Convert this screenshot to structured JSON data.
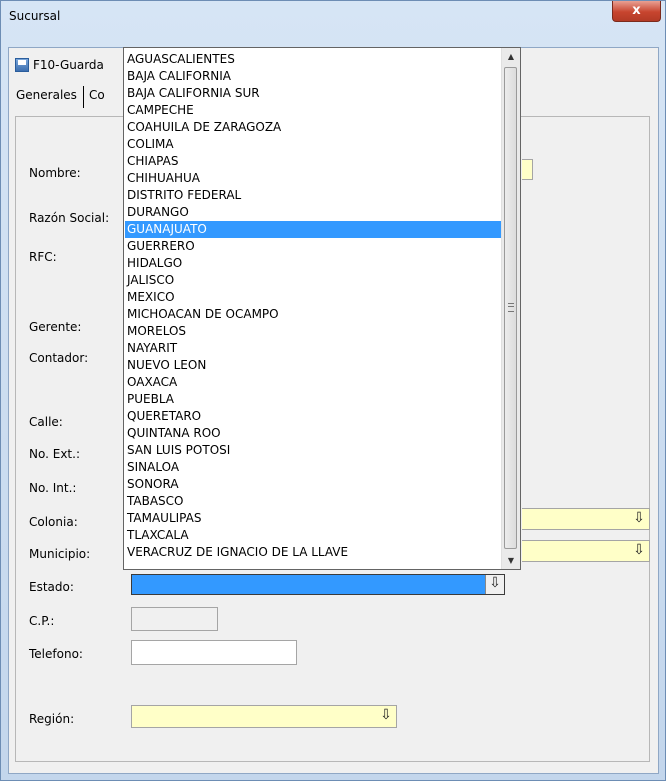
{
  "window": {
    "title": "Sucursal",
    "close_label": "x"
  },
  "toolbar": {
    "save_label": "F10-Guarda",
    "save_icon": "floppy-disk-icon"
  },
  "tabs": [
    {
      "label": "Generales"
    },
    {
      "label": "Co"
    }
  ],
  "form": {
    "labels": {
      "nombre": "Nombre:",
      "razon_social": "Razón Social:",
      "rfc": "RFC:",
      "gerente": "Gerente:",
      "contador": "Contador:",
      "calle": "Calle:",
      "no_ext": "No. Ext.:",
      "no_int": "No. Int.:",
      "colonia": "Colonia:",
      "municipio": "Municipio:",
      "estado": "Estado:",
      "cp": "C.P.:",
      "telefono": "Telefono:",
      "region": "Región:"
    },
    "dropdown_icon": "⇩"
  },
  "estado_dropdown": {
    "selected": "GUANAJUATO",
    "options": [
      "AGUASCALIENTES",
      "BAJA CALIFORNIA",
      "BAJA CALIFORNIA SUR",
      "CAMPECHE",
      "COAHUILA DE ZARAGOZA",
      "COLIMA",
      "CHIAPAS",
      "CHIHUAHUA",
      "DISTRITO FEDERAL",
      "DURANGO",
      "GUANAJUATO",
      "GUERRERO",
      "HIDALGO",
      "JALISCO",
      "MEXICO",
      "MICHOACAN DE OCAMPO",
      "MORELOS",
      "NAYARIT",
      "NUEVO LEON",
      "OAXACA",
      "PUEBLA",
      "QUERETARO",
      "QUINTANA ROO",
      "SAN LUIS POTOSI",
      "SINALOA",
      "SONORA",
      "TABASCO",
      "TAMAULIPAS",
      "TLAXCALA",
      "VERACRUZ DE IGNACIO DE LA LLAVE"
    ]
  },
  "colors": {
    "selection": "#3399ff",
    "required_field": "#ffffc8"
  }
}
